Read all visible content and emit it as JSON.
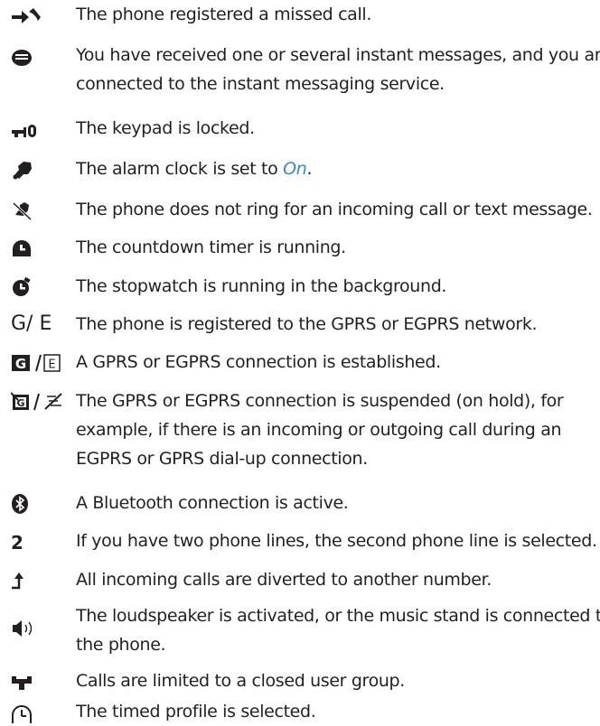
{
  "items": [
    {
      "icon": "missed-call-icon",
      "lines": [
        "The phone registered a missed call."
      ]
    },
    {
      "icon": "instant-message-icon",
      "lines": [
        "You have received one or several instant messages, and you are",
        "connected to the instant messaging service."
      ]
    },
    {
      "icon": "keypad-lock-icon",
      "lines": [
        "The keypad is locked."
      ]
    },
    {
      "icon": "alarm-clock-icon",
      "pre": "The alarm clock is set to ",
      "link": "On",
      "post": "."
    },
    {
      "icon": "silent-ringer-icon",
      "lines": [
        "The phone does not ring for an incoming call or text message."
      ]
    },
    {
      "icon": "countdown-timer-icon",
      "lines": [
        "The countdown timer is running."
      ]
    },
    {
      "icon": "stopwatch-icon",
      "lines": [
        "The stopwatch is running in the background."
      ]
    },
    {
      "icon": "gprs-registered-icon",
      "glyph": "G/ E",
      "lines": [
        "The phone is registered to the GPRS or EGPRS network."
      ]
    },
    {
      "icon": "gprs-connection-icon",
      "lines": [
        "A GPRS or EGPRS connection is established."
      ]
    },
    {
      "icon": "gprs-suspended-icon",
      "lines": [
        "The GPRS or EGPRS connection is suspended (on hold), for",
        "example, if there is an incoming or outgoing call during an",
        "EGPRS or GPRS dial-up connection."
      ]
    },
    {
      "icon": "bluetooth-icon",
      "lines": [
        "A Bluetooth connection is active."
      ]
    },
    {
      "icon": "second-line-icon",
      "glyph": "2",
      "lines": [
        "If you have two phone lines, the second phone line is selected."
      ]
    },
    {
      "icon": "call-divert-icon",
      "lines": [
        "All incoming calls are diverted to another number."
      ]
    },
    {
      "icon": "loudspeaker-icon",
      "lines": [
        "The loudspeaker is activated, or the music stand is connected to",
        "the phone."
      ]
    },
    {
      "icon": "closed-user-group-icon",
      "lines": [
        "Calls are limited to a closed user group."
      ]
    },
    {
      "icon": "timed-profile-icon",
      "lines": [
        "The timed profile is selected."
      ]
    }
  ],
  "colors": {
    "text": "#231f20",
    "link": "#3a86c8"
  }
}
